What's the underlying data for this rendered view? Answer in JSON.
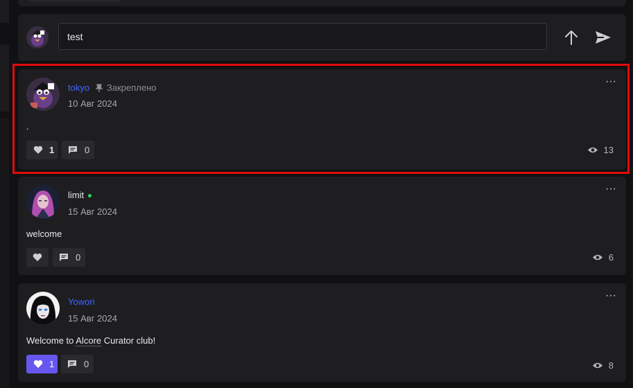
{
  "composer": {
    "input_value": "test",
    "icons": {
      "avatar": "user-avatar",
      "up": "arrow-up-icon",
      "send": "send-icon"
    }
  },
  "posts": [
    {
      "author": "tokyo",
      "author_color": "#3f66ff",
      "pinned_label": "Закреплено",
      "date": "10 Авг 2024",
      "body": ".",
      "likes": "1",
      "comments": "0",
      "views": "13",
      "liked": false,
      "highlighted": true
    },
    {
      "author": "limit",
      "author_color": "#e6e6e8",
      "online": true,
      "date": "15 Авг 2024",
      "body": "welcome",
      "likes": "",
      "comments": "0",
      "views": "6",
      "liked": false
    },
    {
      "author": "Yowori",
      "author_color": "#3f66ff",
      "date": "15 Авг 2024",
      "body_prefix": "Welcome to ",
      "body_link": "Alcore",
      "body_suffix": " Curator club!",
      "likes": "1",
      "comments": "0",
      "views": "8",
      "liked": true
    }
  ],
  "colors": {
    "like_active": "#6657ee",
    "highlight_border": "#e30b0b",
    "online": "#2bd36a"
  }
}
